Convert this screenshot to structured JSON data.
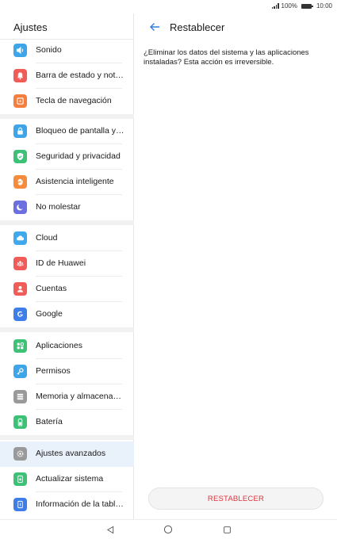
{
  "status_bar": {
    "battery": "100%",
    "time": "10:00"
  },
  "left_pane": {
    "title": "Ajustes",
    "items": [
      {
        "label": "Sonido",
        "icon": "speaker-icon",
        "color": "#3ea6e8"
      },
      {
        "label": "Barra de estado y notificaciones",
        "icon": "bell-icon",
        "color": "#f05c58"
      },
      {
        "label": "Tecla de navegación",
        "icon": "nav-key-icon",
        "color": "#f57e3f"
      },
      {
        "label": "Bloqueo de pantalla y contraseñas",
        "icon": "lock-icon",
        "color": "#3ea6e8"
      },
      {
        "label": "Seguridad y privacidad",
        "icon": "shield-check-icon",
        "color": "#3cc177"
      },
      {
        "label": "Asistencia inteligente",
        "icon": "hand-icon",
        "color": "#f58b3b"
      },
      {
        "label": "No molestar",
        "icon": "moon-icon",
        "color": "#6c6fe0"
      },
      {
        "label": "Cloud",
        "icon": "cloud-icon",
        "color": "#40a9ee"
      },
      {
        "label": "ID de Huawei",
        "icon": "huawei-icon",
        "color": "#f05c58"
      },
      {
        "label": "Cuentas",
        "icon": "person-icon",
        "color": "#f05c58"
      },
      {
        "label": "Google",
        "icon": "google-icon",
        "color": "#3e7ee8"
      },
      {
        "label": "Aplicaciones",
        "icon": "apps-grid-icon",
        "color": "#3cc177"
      },
      {
        "label": "Permisos",
        "icon": "key-icon",
        "color": "#3ea6e8"
      },
      {
        "label": "Memoria y almacenamiento",
        "icon": "storage-icon",
        "color": "#9a9a9a"
      },
      {
        "label": "Batería",
        "icon": "battery-icon",
        "color": "#3cc177"
      },
      {
        "label": "Ajustes avanzados",
        "icon": "gear-icon",
        "color": "#9a9a9a"
      },
      {
        "label": "Actualizar sistema",
        "icon": "system-update-icon",
        "color": "#3cc177"
      },
      {
        "label": "Información de la tableta",
        "icon": "tablet-info-icon",
        "color": "#3e7ee8"
      }
    ]
  },
  "right_pane": {
    "title": "Restablecer",
    "message": "¿Eliminar los datos del sistema y las aplicaciones instaladas? Esta acción es irreversible.",
    "reset_button": "RESTABLECER"
  }
}
